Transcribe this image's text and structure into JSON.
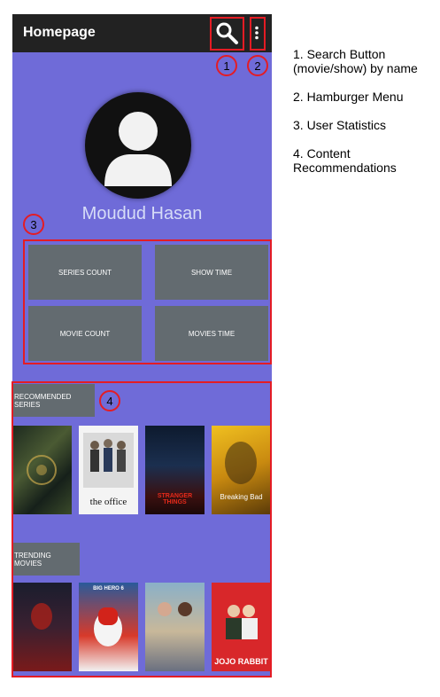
{
  "appbar": {
    "title": "Homepage",
    "search_icon": "search-icon",
    "menu_icon": "more-vert-icon"
  },
  "profile": {
    "avatar_icon": "person-icon",
    "name": "Moudud Hasan"
  },
  "stats": [
    {
      "label": "SERIES COUNT"
    },
    {
      "label": "SHOW TIME"
    },
    {
      "label": "MOVIE COUNT"
    },
    {
      "label": "MOVIES TIME"
    }
  ],
  "recommended_series": {
    "label": "RECOMMENDED SERIES",
    "posters": [
      {
        "title": ""
      },
      {
        "title": "the office"
      },
      {
        "title": "STRANGER THINGS"
      },
      {
        "title": "Breaking Bad"
      }
    ]
  },
  "trending_movies": {
    "label": "TRENDING MOVIES",
    "posters": [
      {
        "title": ""
      },
      {
        "title": "BIG HERO 6"
      },
      {
        "title": ""
      },
      {
        "title": "JOJO RABBIT"
      }
    ]
  },
  "annotations": {
    "markers": [
      "1",
      "2",
      "3",
      "4"
    ],
    "legend": [
      "1. Search Button (movie/show) by name",
      "2. Hamburger Menu",
      "3. User Statistics",
      "4. Content Recommendations"
    ],
    "accent_color": "#e41c24"
  },
  "colors": {
    "background": "#6f6bd8",
    "appbar": "#222222",
    "tile": "#636b70"
  }
}
